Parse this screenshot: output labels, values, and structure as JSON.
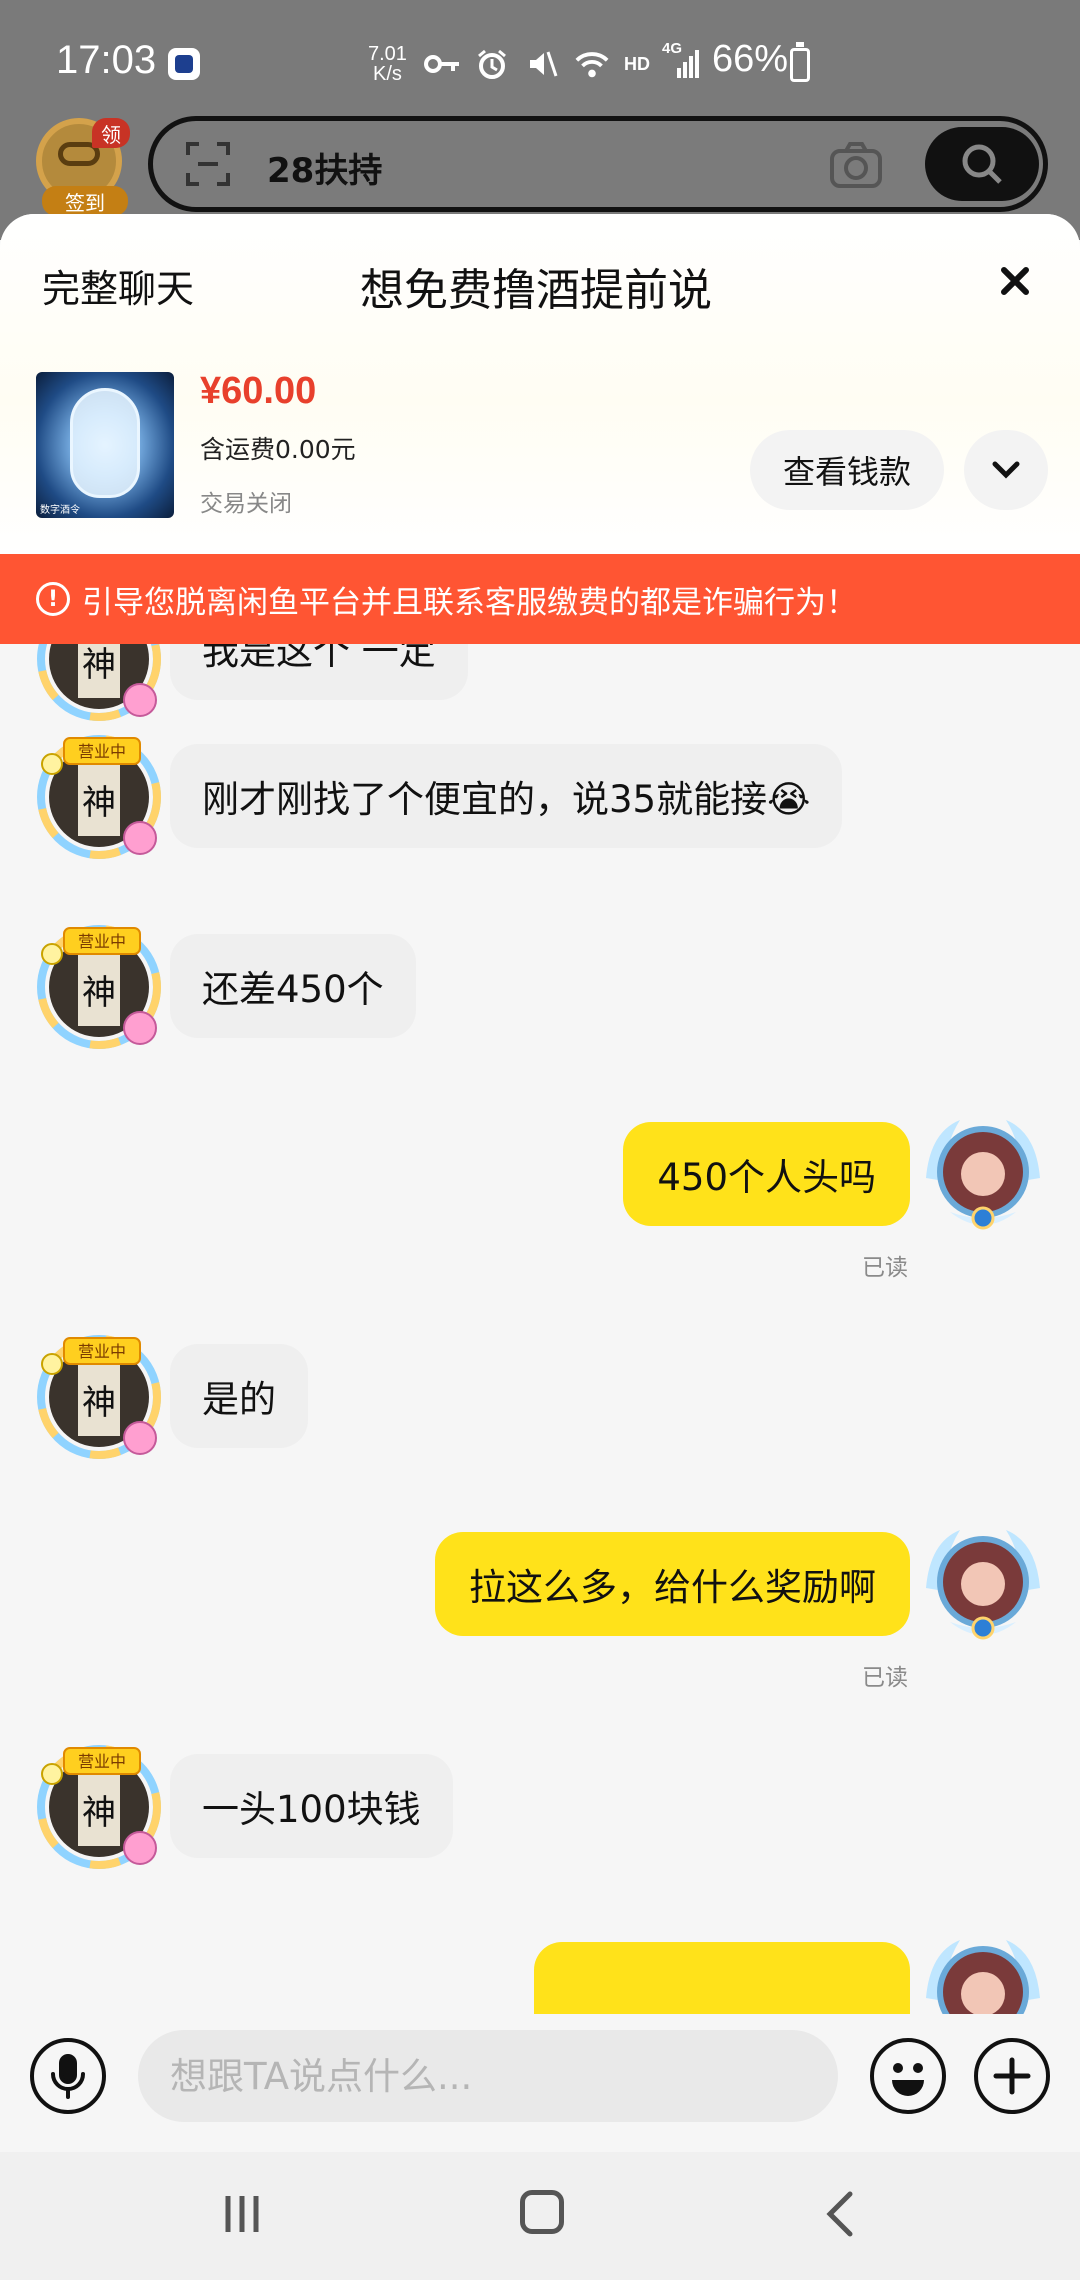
{
  "status_bar": {
    "time": "17:03",
    "net_speed_value": "7.01",
    "net_speed_unit": "K/s",
    "hd_label": "HD",
    "network_label": "4G",
    "battery": "66%"
  },
  "top_app": {
    "checkin_badge": "领",
    "checkin_label": "签到",
    "search_text": "28扶持"
  },
  "sheet": {
    "full_chat_label": "完整聊天",
    "title": "想免费撸酒提前说",
    "close_icon": "close-icon"
  },
  "product": {
    "price": "¥60.00",
    "shipping": "含运费0.00元",
    "status": "交易关闭",
    "thumb_caption": "数字酒令",
    "view_money_label": "查看钱款"
  },
  "warning": {
    "icon": "!",
    "text": "引导您脱离闲鱼平台并且联系客服缴费的都是诈骗行为！"
  },
  "messages": [
    {
      "side": "left",
      "text": "我是这个 一定"
    },
    {
      "side": "left",
      "text": "刚才刚找了个便宜的，说35就能接😭"
    },
    {
      "side": "left",
      "text": "还差450个"
    },
    {
      "side": "right",
      "text": "450个人头吗",
      "read": "已读"
    },
    {
      "side": "left",
      "text": "是的"
    },
    {
      "side": "right",
      "text": "拉这么多，给什么奖励啊",
      "read": "已读"
    },
    {
      "side": "left",
      "text": "一头100块钱"
    },
    {
      "side": "right",
      "text": ""
    }
  ],
  "avatar_left": {
    "badge_text": "营业中",
    "char": "神"
  },
  "input": {
    "placeholder": "想跟TA说点什么..."
  },
  "colors": {
    "accent_yellow": "#ffe21a",
    "warning_orange": "#ff5533",
    "price_red": "#e8402c"
  }
}
